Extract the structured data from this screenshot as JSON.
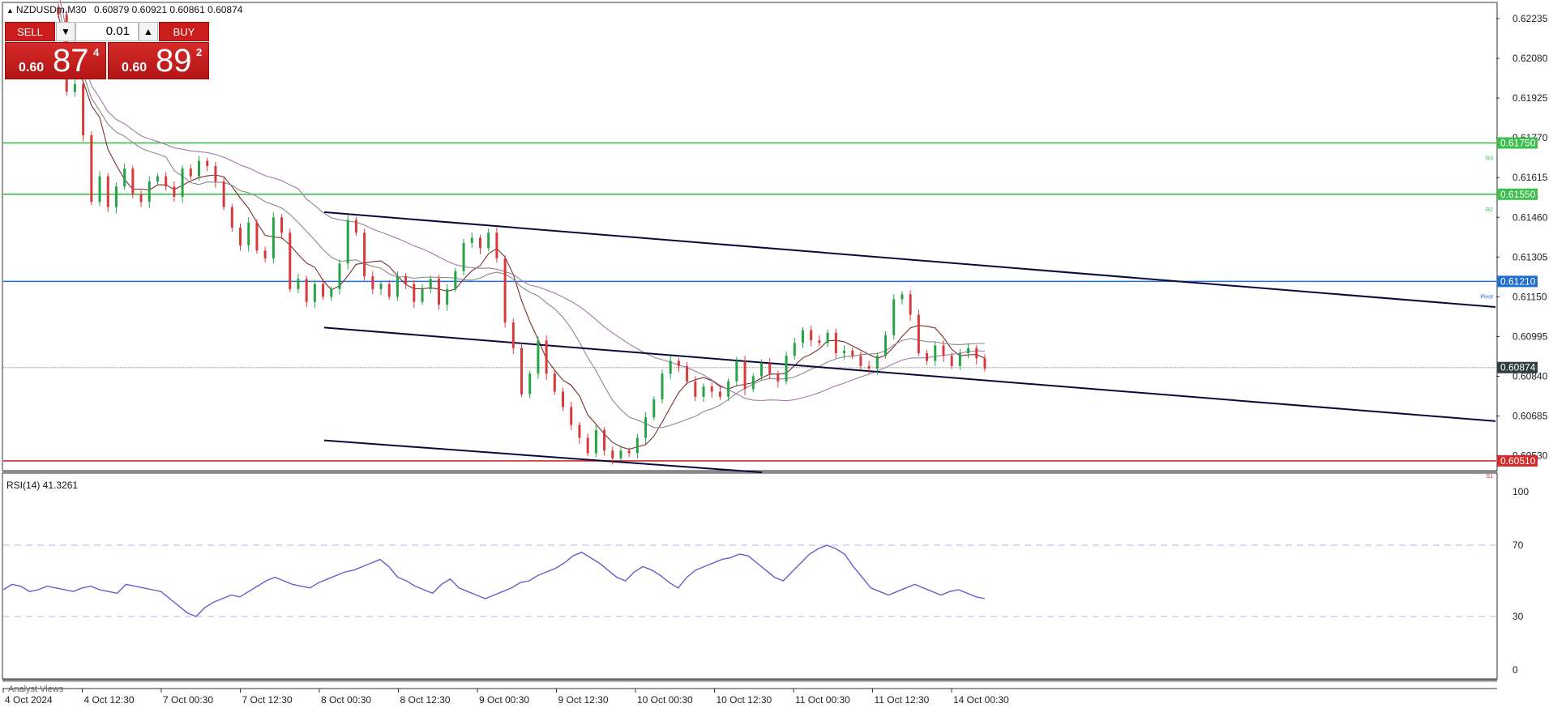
{
  "header": {
    "symbol": "NZDUSDm,M30",
    "ohlc": "0.60879 0.60921 0.60861 0.60874"
  },
  "trade_panel": {
    "sell_label": "SELL",
    "buy_label": "BUY",
    "volume": "0.01",
    "sell_prefix": "0.60",
    "sell_big": "87",
    "sell_sup": "4",
    "buy_prefix": "0.60",
    "buy_big": "89",
    "buy_sup": "2"
  },
  "price_axis": {
    "ticks": [
      "0.62235",
      "0.62080",
      "0.61925",
      "0.61770",
      "0.61615",
      "0.61460",
      "0.61305",
      "0.61150",
      "0.60995",
      "0.60840",
      "0.60685",
      "0.60530"
    ],
    "ylim": [
      0.60475,
      0.62295
    ]
  },
  "levels": [
    {
      "name": "R3",
      "price": 0.6175,
      "label": "0.61750",
      "tag": "R3",
      "color": "#3cbf4c"
    },
    {
      "name": "R2",
      "price": 0.6155,
      "label": "0.61550",
      "tag": "R2",
      "color": "#3cbf4c"
    },
    {
      "name": "Pivot",
      "price": 0.6121,
      "label": "0.61210",
      "tag": "Pivot",
      "color": "#1f6fce"
    },
    {
      "name": "S1",
      "price": 0.6051,
      "label": "0.60510",
      "tag": "S1",
      "color": "#d12b2b"
    }
  ],
  "current_price": {
    "price": 0.60874,
    "label": "0.60874",
    "color": "#2f3f3f"
  },
  "time_axis": {
    "labels": [
      "4 Oct 2024",
      "4 Oct 12:30",
      "7 Oct 00:30",
      "7 Oct 12:30",
      "8 Oct 00:30",
      "8 Oct 12:30",
      "9 Oct 00:30",
      "9 Oct 12:30",
      "10 Oct 00:30",
      "10 Oct 12:30",
      "11 Oct 00:30",
      "11 Oct 12:30",
      "14 Oct 00:30"
    ]
  },
  "rsi": {
    "label": "RSI(14) 41.3261",
    "ticks": [
      "100",
      "70",
      "30",
      "0"
    ],
    "levels": [
      70,
      30
    ],
    "level_color": "#c8a8e0",
    "line_color": "#6a5acd"
  },
  "bottom_tab": "Analyst Views",
  "chart_data": {
    "type": "candlestick",
    "title": "NZDUSDm,M30",
    "xlabel": "",
    "ylabel": "",
    "ylim": [
      0.60475,
      0.62295
    ],
    "grid": false,
    "bull_color": "#26a346",
    "bear_color": "#d63a3a",
    "closes": [
      0.6225,
      0.6195,
      0.6198,
      0.6178,
      0.6152,
      0.6162,
      0.615,
      0.6158,
      0.6165,
      0.6155,
      0.6152,
      0.616,
      0.6162,
      0.6158,
      0.6154,
      0.6165,
      0.6162,
      0.6168,
      0.6166,
      0.616,
      0.615,
      0.6142,
      0.6135,
      0.6144,
      0.6133,
      0.613,
      0.6146,
      0.614,
      0.6118,
      0.6122,
      0.6113,
      0.612,
      0.6115,
      0.6118,
      0.6128,
      0.6145,
      0.614,
      0.6123,
      0.6118,
      0.612,
      0.6115,
      0.6123,
      0.612,
      0.6113,
      0.6118,
      0.6122,
      0.6112,
      0.6118,
      0.6125,
      0.6136,
      0.6138,
      0.6134,
      0.614,
      0.613,
      0.6105,
      0.6095,
      0.6077,
      0.6085,
      0.6098,
      0.6085,
      0.6078,
      0.6072,
      0.6065,
      0.606,
      0.6054,
      0.6063,
      0.6055,
      0.6052,
      0.6055,
      0.6054,
      0.606,
      0.6068,
      0.6075,
      0.6085,
      0.609,
      0.6088,
      0.6082,
      0.6076,
      0.608,
      0.6078,
      0.6076,
      0.6082,
      0.609,
      0.6079,
      0.6084,
      0.6089,
      0.6085,
      0.6082,
      0.6092,
      0.6097,
      0.6102,
      0.6098,
      0.6097,
      0.6101,
      0.6093,
      0.6094,
      0.6092,
      0.6088,
      0.6087,
      0.6092,
      0.61,
      0.6114,
      0.6116,
      0.6108,
      0.6093,
      0.609,
      0.6096,
      0.6092,
      0.6088,
      0.6093,
      0.6095,
      0.6091,
      0.6087
    ],
    "moving_averages": [
      {
        "period_hint": "fast",
        "color": "#7a2e2e"
      },
      {
        "period_hint": "medium",
        "color": "#8a8a8a"
      },
      {
        "period_hint": "slow",
        "color": "#a07aa6"
      }
    ],
    "channel": [
      {
        "from_x_label": "8 Oct 00:30",
        "to_x_label": "edge",
        "from_price": 0.6148,
        "to_price": 0.6111
      },
      {
        "from_x_label": "8 Oct 00:30",
        "to_x_label": "edge",
        "from_price": 0.6103,
        "to_price": 0.60665
      },
      {
        "from_x_label": "8 Oct 00:30",
        "to_x_label": "9 Oct 12:30",
        "from_price": 0.6059,
        "to_price": 0.60465
      }
    ],
    "rsi_values": [
      45,
      48,
      47,
      44,
      45,
      47,
      46,
      45,
      44,
      46,
      47,
      45,
      44,
      43,
      48,
      47,
      46,
      45,
      44,
      40,
      36,
      32,
      30,
      35,
      38,
      40,
      42,
      41,
      44,
      47,
      50,
      52,
      50,
      48,
      47,
      46,
      49,
      51,
      53,
      55,
      56,
      58,
      60,
      62,
      58,
      52,
      50,
      47,
      45,
      43,
      48,
      51,
      46,
      44,
      42,
      40,
      42,
      44,
      46,
      49,
      50,
      53,
      55,
      57,
      60,
      64,
      66,
      63,
      60,
      56,
      52,
      50,
      55,
      58,
      56,
      53,
      49,
      46,
      52,
      56,
      58,
      60,
      62,
      63,
      65,
      64,
      60,
      56,
      52,
      50,
      55,
      60,
      65,
      68,
      70,
      68,
      65,
      58,
      52,
      46,
      44,
      42,
      44,
      46,
      48,
      46,
      44,
      42,
      44,
      45,
      43,
      41,
      40
    ]
  }
}
